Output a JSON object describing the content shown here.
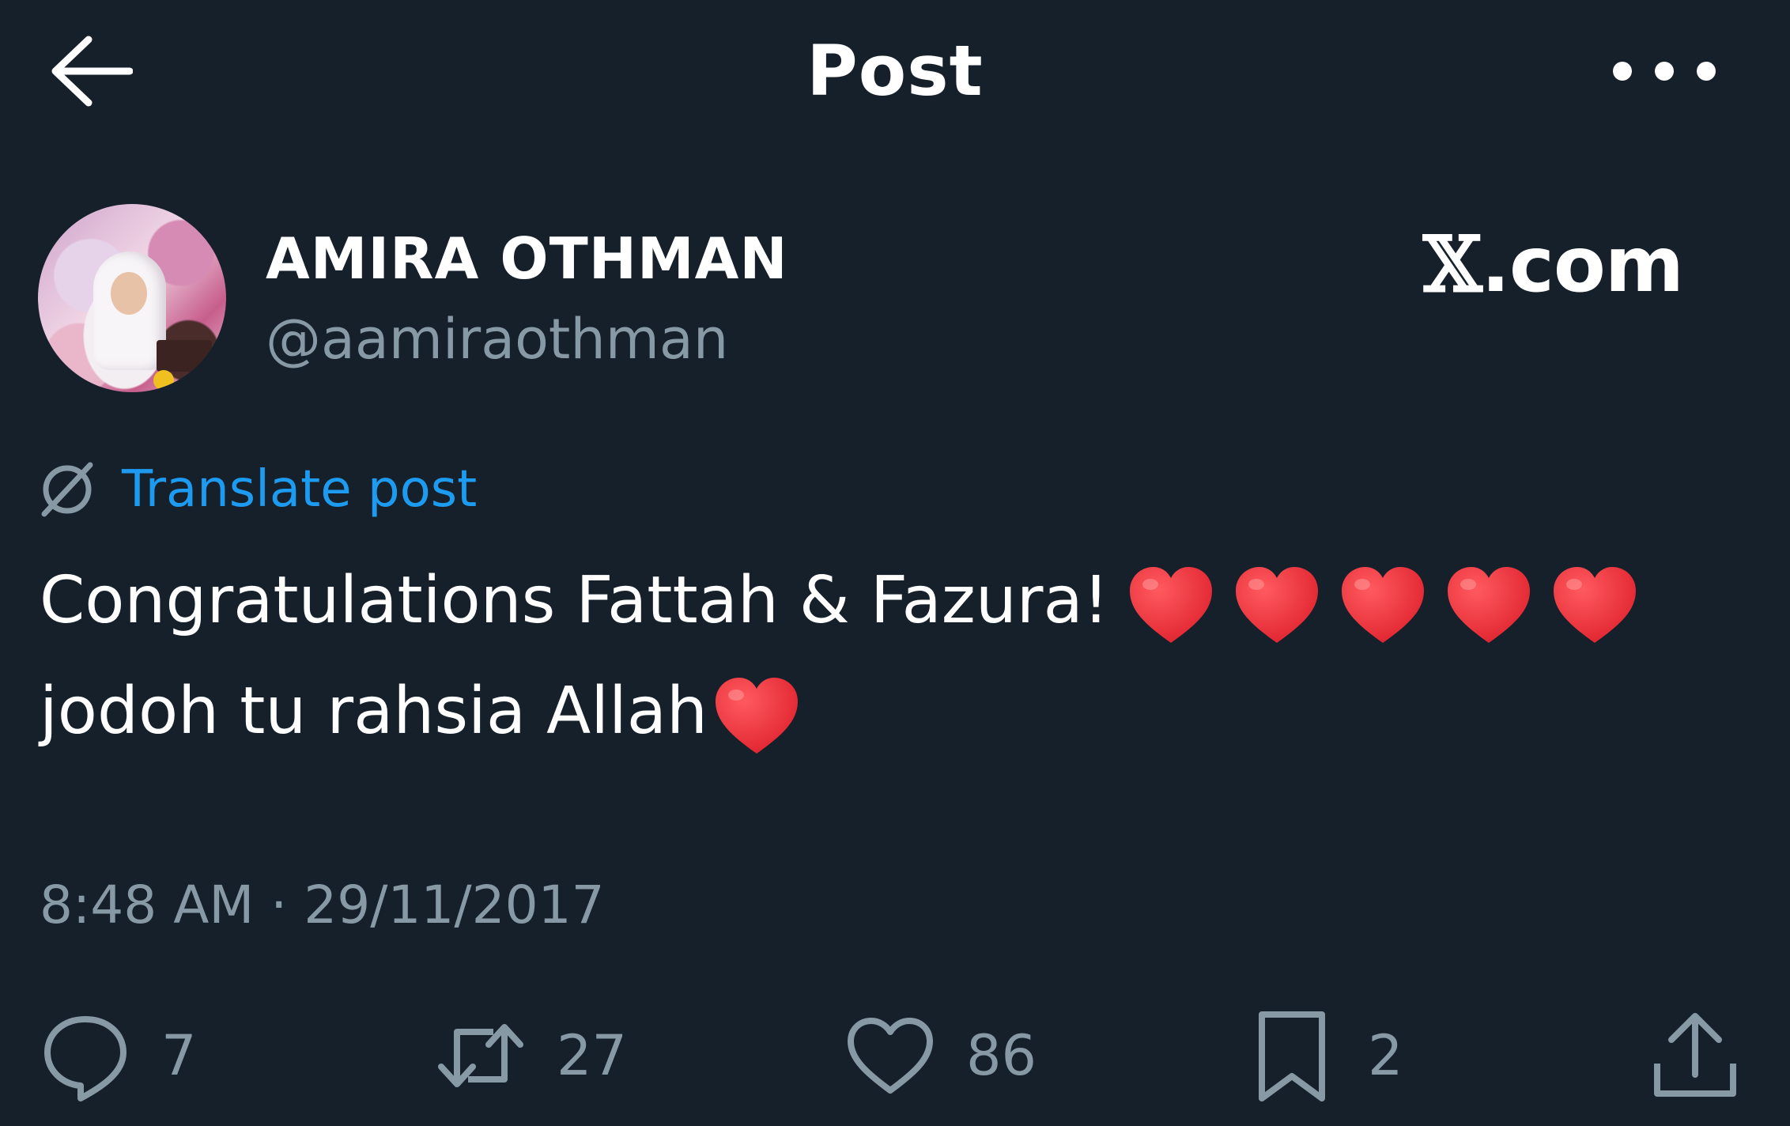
{
  "header": {
    "title": "Post",
    "back_icon": "arrow-left-icon",
    "more_icon": "more-horizontal-icon"
  },
  "author": {
    "name": "AMIRA OTHMAN",
    "handle": "@aamiraothman",
    "avatar": "avatar-photo"
  },
  "watermark": {
    "logo": "𝕏",
    "text": ".com"
  },
  "translate": {
    "label": "Translate post",
    "icon": "translate-globe-icon"
  },
  "tweet": {
    "line1": "Congratulations Fattah & Fazura!",
    "line1_hearts": 5,
    "line2": "jodoh tu rahsia Allah",
    "line2_hearts": 1
  },
  "timestamp": "8:48 AM · 29/11/2017",
  "actions": [
    {
      "name": "reply",
      "icon": "reply-icon",
      "count": "7"
    },
    {
      "name": "repost",
      "icon": "repost-icon",
      "count": "27"
    },
    {
      "name": "like",
      "icon": "heart-outline-icon",
      "count": "86"
    },
    {
      "name": "bookmark",
      "icon": "bookmark-icon",
      "count": "2"
    },
    {
      "name": "share",
      "icon": "share-icon",
      "count": ""
    }
  ],
  "colors": {
    "background": "#15202b",
    "text": "#ffffff",
    "secondary_text": "#8899a6",
    "link": "#1d9bf0",
    "heart": "#e0242f"
  }
}
